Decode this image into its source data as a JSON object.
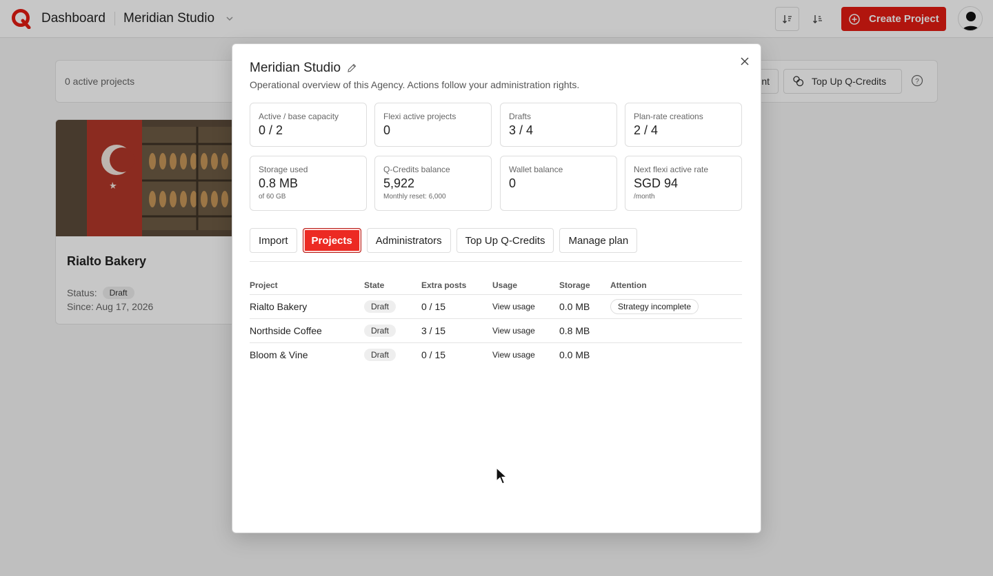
{
  "topbar": {
    "title": "Dashboard",
    "org": "Meridian Studio",
    "create_label": "Create Project",
    "accent": "#e31b12"
  },
  "background": {
    "active_projects": "0 active projects",
    "account_btn": "nt",
    "topup_btn": "Top Up Q-Credits",
    "card": {
      "title": "Rialto Bakery",
      "status_label": "Status:",
      "status": "Draft",
      "since": "Since: Aug 17, 2026"
    }
  },
  "modal": {
    "title": "Meridian Studio",
    "subtitle": "Operational overview of this Agency. Actions follow your administration rights.",
    "stats": [
      {
        "label": "Active / base capacity",
        "value": "0 / 2",
        "note": ""
      },
      {
        "label": "Flexi active projects",
        "value": "0",
        "note": ""
      },
      {
        "label": "Drafts",
        "value": "3 / 4",
        "note": ""
      },
      {
        "label": "Plan-rate creations",
        "value": "2 / 4",
        "note": ""
      },
      {
        "label": "Storage used",
        "value": "0.8 MB",
        "note": "of 60 GB"
      },
      {
        "label": "Q-Credits balance",
        "value": "5,922",
        "note": "Monthly reset: 6,000"
      },
      {
        "label": "Wallet balance",
        "value": "0",
        "note": ""
      },
      {
        "label": "Next flexi active rate",
        "value": "SGD 94",
        "note": "/month"
      }
    ],
    "tabs": [
      {
        "label": "Import",
        "active": false
      },
      {
        "label": "Projects",
        "active": true
      },
      {
        "label": "Administrators",
        "active": false
      },
      {
        "label": "Top Up Q-Credits",
        "active": false
      },
      {
        "label": "Manage plan",
        "active": false
      }
    ],
    "table": {
      "headers": [
        "Project",
        "State",
        "Extra posts",
        "Usage",
        "Storage",
        "Attention"
      ],
      "rows": [
        {
          "project": "Rialto Bakery",
          "state": "Draft",
          "extra": "0 / 15",
          "usage": "View usage",
          "storage": "0.0 MB",
          "attention": "Strategy incomplete"
        },
        {
          "project": "Northside Coffee",
          "state": "Draft",
          "extra": "3 / 15",
          "usage": "View usage",
          "storage": "0.8 MB",
          "attention": ""
        },
        {
          "project": "Bloom & Vine",
          "state": "Draft",
          "extra": "0 / 15",
          "usage": "View usage",
          "storage": "0.0 MB",
          "attention": ""
        }
      ]
    }
  }
}
